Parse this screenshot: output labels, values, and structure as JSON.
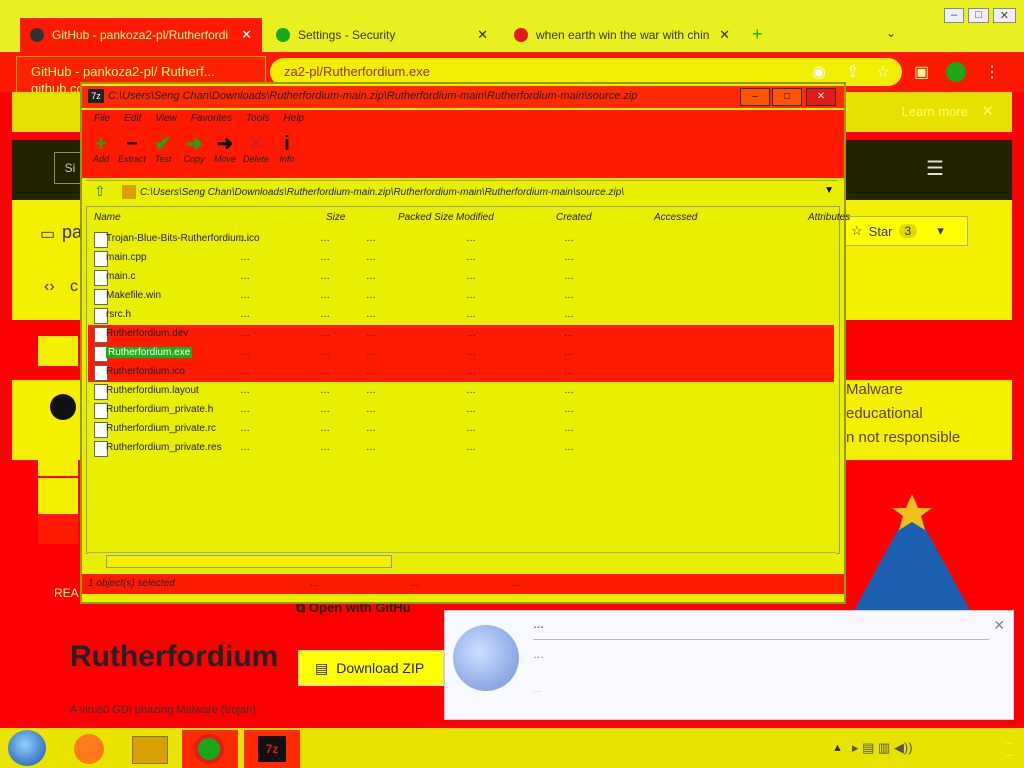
{
  "browser": {
    "tabs": [
      {
        "label": "GitHub - pankoza2-pl/Rutherfordi",
        "active": true
      },
      {
        "label": "Settings - Security",
        "active": false
      },
      {
        "label": "when earth win the war with chin",
        "active": false
      }
    ],
    "new_tab_label": "+",
    "url": "za2-pl/Rutherfordium.exe",
    "tooltip": "GitHub - pankoza2-pl/ Rutherf... github.com",
    "infobar_link": "Learn more"
  },
  "github": {
    "sign_label": "Si",
    "repo_prefix": "pa",
    "star_label": "Star",
    "star_count": "3",
    "code_label": "c",
    "disclaimer": [
      "Malware",
      "educational",
      "n not responsible"
    ],
    "readme_label": "REA",
    "heading": "Rutherfordium",
    "open_with": "Open with GitHu",
    "download_zip": "Download ZIP",
    "bottom_text": "A virus0 GDI phazing Malware (trojan)"
  },
  "sevenzip": {
    "title": "C:\\Users\\Seng Chan\\Downloads\\Rutherfordium-main.zip\\Rutherfordium-main\\Rutherfordium-main\\source.zip",
    "app_icon": "7z",
    "menu": [
      "File",
      "Edit",
      "View",
      "Favorites",
      "Tools",
      "Help"
    ],
    "toolbar": [
      {
        "icon": "add-icon",
        "label": "Add",
        "glyph": "+",
        "color": "#19a819"
      },
      {
        "icon": "extract-icon",
        "label": "Extract",
        "glyph": "−",
        "color": "#111"
      },
      {
        "icon": "test-icon",
        "label": "Test",
        "glyph": "✔",
        "color": "#19a819"
      },
      {
        "icon": "copy-icon",
        "label": "Copy",
        "glyph": "➜",
        "color": "#19a819"
      },
      {
        "icon": "move-icon",
        "label": "Move",
        "glyph": "➜",
        "color": "#111"
      },
      {
        "icon": "delete-icon",
        "label": "Delete",
        "glyph": "✕",
        "color": "#e31b1b"
      },
      {
        "icon": "info-icon",
        "label": "Info",
        "glyph": "i",
        "color": "#111"
      }
    ],
    "address": "C:\\Users\\Seng Chan\\Downloads\\Rutherfordium-main.zip\\Rutherfordium-main\\Rutherfordium-main\\source.zip\\",
    "columns": [
      "Name",
      "Size",
      "Packed Size",
      "Modified",
      "Created",
      "Accessed",
      "Attributes"
    ],
    "files": [
      {
        "name": "Trojan-Blue-Bits-Rutherfordium.ico",
        "size": "…",
        "packed": "…",
        "modified": "…",
        "created": "…",
        "accessed": "…",
        "band": "yellow"
      },
      {
        "name": "main.cpp",
        "size": "…",
        "packed": "…",
        "modified": "…",
        "created": "…",
        "accessed": "…",
        "band": "yellow"
      },
      {
        "name": "main.c",
        "size": "…",
        "packed": "…",
        "modified": "…",
        "created": "…",
        "accessed": "…",
        "band": "yellow"
      },
      {
        "name": "Makefile.win",
        "size": "…",
        "packed": "…",
        "modified": "…",
        "created": "…",
        "accessed": "…",
        "band": "yellow"
      },
      {
        "name": "rsrc.h",
        "size": "…",
        "packed": "…",
        "modified": "…",
        "created": "…",
        "accessed": "…",
        "band": "yellow"
      },
      {
        "name": "Rutherfordium.dev",
        "size": "…",
        "packed": "…",
        "modified": "…",
        "created": "…",
        "accessed": "…",
        "band": "red"
      },
      {
        "name": "Rutherfordium.exe",
        "size": "…",
        "packed": "…",
        "modified": "…",
        "created": "…",
        "accessed": "…",
        "band": "red",
        "selected": true
      },
      {
        "name": "Rutherfordium.ico",
        "size": "…",
        "packed": "…",
        "modified": "…",
        "created": "…",
        "accessed": "…",
        "band": "red"
      },
      {
        "name": "Rutherfordium.layout",
        "size": "…",
        "packed": "…",
        "modified": "…",
        "created": "…",
        "accessed": "…",
        "band": "yellow"
      },
      {
        "name": "Rutherfordium_private.h",
        "size": "…",
        "packed": "…",
        "modified": "…",
        "created": "…",
        "accessed": "…",
        "band": "yellow"
      },
      {
        "name": "Rutherfordium_private.rc",
        "size": "…",
        "packed": "…",
        "modified": "…",
        "created": "…",
        "accessed": "…",
        "band": "yellow"
      },
      {
        "name": "Rutherfordium_private.res",
        "size": "…",
        "packed": "…",
        "modified": "…",
        "created": "…",
        "accessed": "…",
        "band": "yellow"
      }
    ],
    "status": [
      "1 object(s) selected",
      "…",
      "…",
      "…"
    ]
  },
  "notification": {
    "title": "…",
    "subtitle": "…",
    "body": "…"
  },
  "taskbar": {
    "clock": "…",
    "date": "…"
  },
  "colors": {
    "primary_red": "#ff1a00",
    "primary_yellow": "#e8f000",
    "select_green": "#18b018"
  }
}
